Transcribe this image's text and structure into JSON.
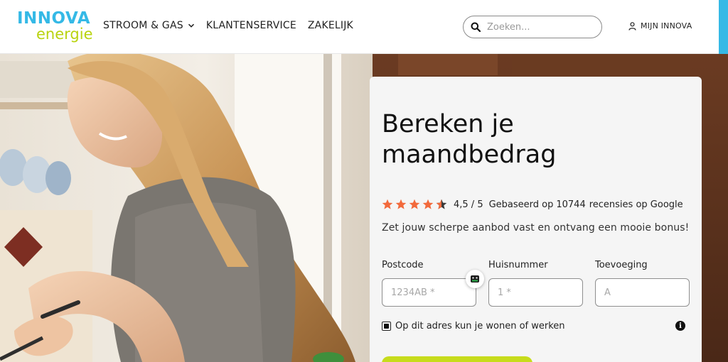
{
  "header": {
    "logo": {
      "line1": "INNOVA",
      "line2": "energie"
    },
    "nav": [
      {
        "label": "STROOM & GAS",
        "has_dropdown": true
      },
      {
        "label": "KLANTENSERVICE",
        "has_dropdown": false
      },
      {
        "label": "ZAKELIJK",
        "has_dropdown": false
      }
    ],
    "search": {
      "placeholder": "Zoeken...",
      "value": ""
    },
    "account_label": "MIJN INNOVA"
  },
  "hero": {
    "card": {
      "title": "Bereken je maandbedrag",
      "rating": {
        "stars": 4.5,
        "score": "4,5 / 5",
        "based_on": "Gebaseerd op",
        "count": "10744",
        "suffix": "recensies op Google"
      },
      "tagline": "Zet jouw scherpe aanbod vast en ontvang een mooie bonus!",
      "fields": [
        {
          "label": "Postcode",
          "placeholder": "1234AB *",
          "value": ""
        },
        {
          "label": "Huisnummer",
          "placeholder": "1 *",
          "value": ""
        },
        {
          "label": "Toevoeging",
          "placeholder": "A",
          "value": ""
        }
      ],
      "checkbox": {
        "label": "Op dit adres kun je wonen of werken",
        "checked": true
      },
      "info_icon": "i"
    }
  },
  "colors": {
    "brand_blue": "#35b9e6",
    "brand_green": "#b9d30f",
    "star_orange": "#f26a3c",
    "cta_green": "#c7dc1c",
    "card_bg": "#f5f5f5"
  },
  "icons": [
    "chevron-down-icon",
    "search-icon",
    "user-icon",
    "star-icon",
    "autofill-icon",
    "info-icon"
  ]
}
